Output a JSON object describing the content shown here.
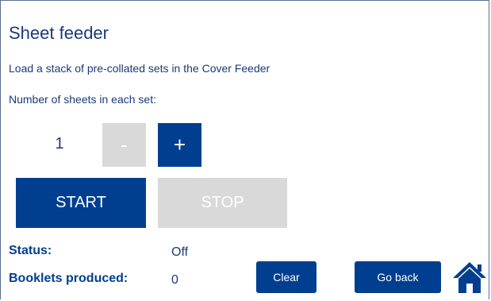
{
  "page": {
    "title": "Sheet feeder",
    "description": "Load a stack of pre-collated sets in the Cover Feeder",
    "sheets_label": "Number of sheets in each set:"
  },
  "controls": {
    "sheet_count": "1",
    "minus_label": "-",
    "plus_label": "+",
    "start_label": "START",
    "stop_label": "STOP"
  },
  "status": {
    "status_label": "Status:",
    "status_value": "Off",
    "booklets_label": "Booklets produced:",
    "booklets_value": "0"
  },
  "footer": {
    "clear_label": "Clear",
    "back_label": "Go back",
    "home_icon": "home-icon"
  },
  "colors": {
    "accent": "#003f8f",
    "disabled": "#d9d9d9",
    "text": "#1a3a7a"
  }
}
